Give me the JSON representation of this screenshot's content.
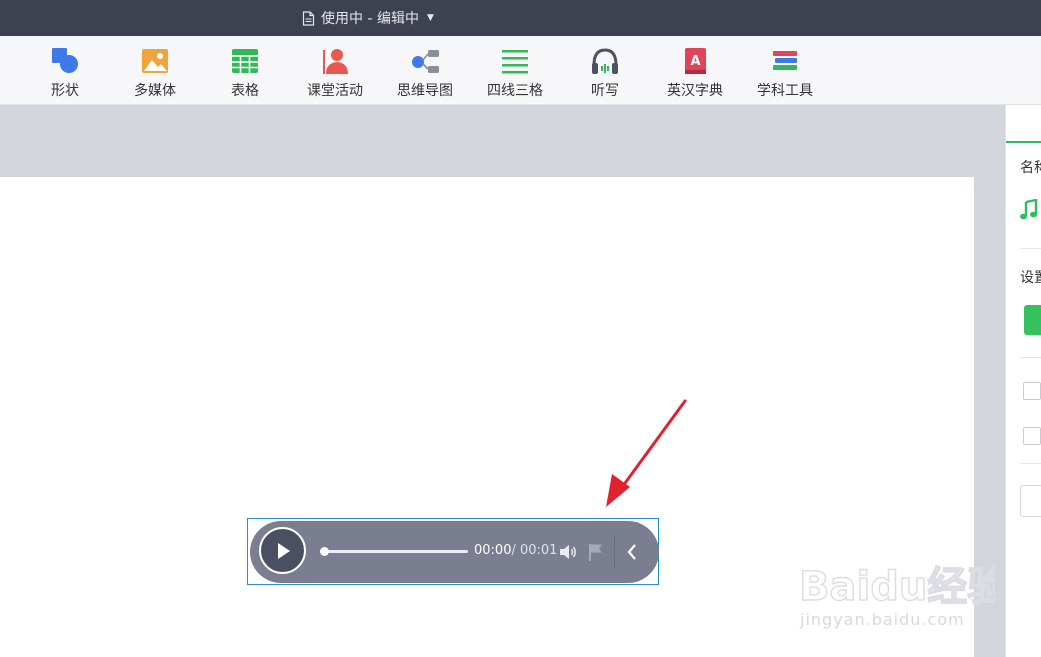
{
  "window": {
    "title": "使用中 - 编辑中"
  },
  "toolbar": {
    "items": [
      {
        "label": "形状",
        "icon": "shape-icon"
      },
      {
        "label": "多媒体",
        "icon": "image-icon"
      },
      {
        "label": "表格",
        "icon": "table-icon"
      },
      {
        "label": "课堂活动",
        "icon": "class-activity-icon"
      },
      {
        "label": "思维导图",
        "icon": "mind-map-icon"
      },
      {
        "label": "四线三格",
        "icon": "four-lines-icon"
      },
      {
        "label": "听写",
        "icon": "headphones-icon"
      },
      {
        "label": "英汉字典",
        "icon": "dictionary-icon"
      },
      {
        "label": "学科工具",
        "icon": "subject-tools-icon"
      }
    ]
  },
  "panel": {
    "name_label": "名称",
    "settings_label": "设置"
  },
  "player": {
    "current_time": "00:00",
    "total_time": "/ 00:01",
    "progress": 0
  },
  "watermark": {
    "brand": "Baidu经验",
    "url": "jingyan.baidu.com"
  },
  "colors": {
    "titlebar": "#3d4150",
    "accent_green": "#2ebc5c",
    "player_bg": "#7a7e90",
    "selection": "#2b8ec9",
    "arrow": "#e02130"
  }
}
